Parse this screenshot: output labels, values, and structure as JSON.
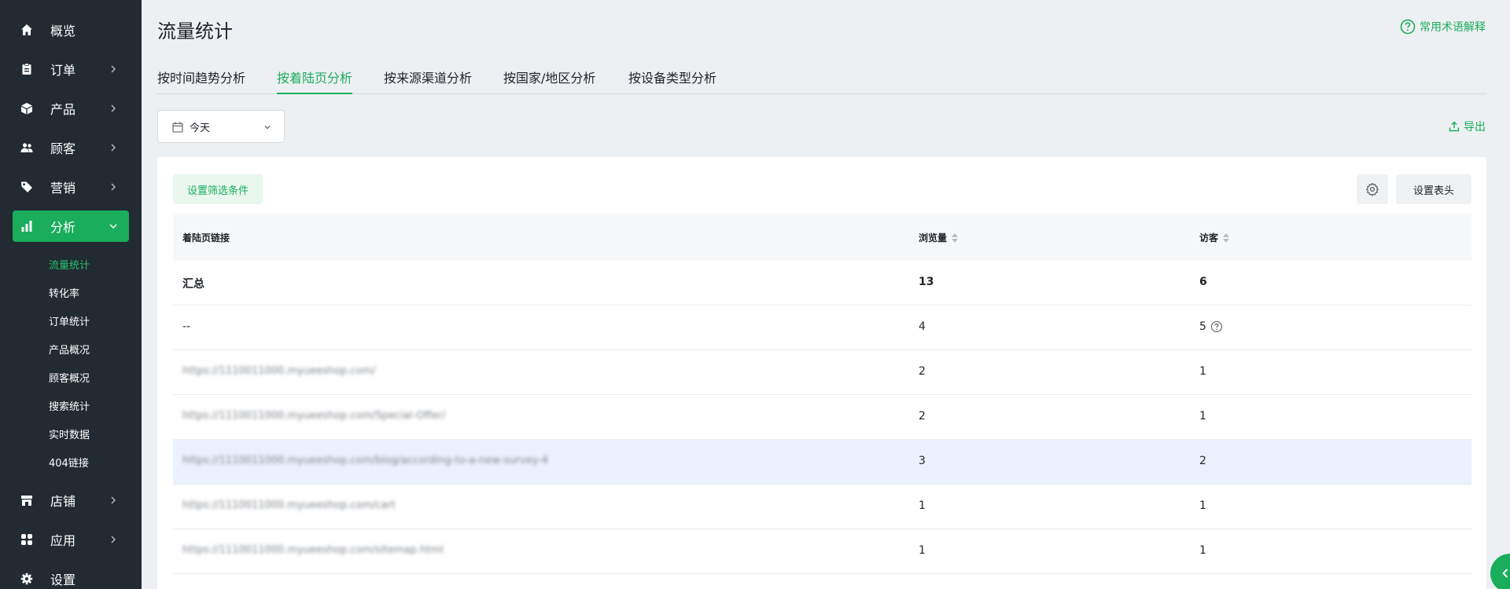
{
  "sidebar": {
    "items": [
      {
        "label": "概览",
        "icon": "home-icon"
      },
      {
        "label": "订单",
        "icon": "clipboard-icon"
      },
      {
        "label": "产品",
        "icon": "box-icon"
      },
      {
        "label": "顾客",
        "icon": "users-icon"
      },
      {
        "label": "营销",
        "icon": "tag-icon"
      },
      {
        "label": "分析",
        "icon": "chart-icon"
      },
      {
        "label": "店铺",
        "icon": "store-icon"
      },
      {
        "label": "应用",
        "icon": "apps-icon"
      },
      {
        "label": "设置",
        "icon": "gear-icon"
      }
    ],
    "sub_items": [
      "流量统计",
      "转化率",
      "订单统计",
      "产品概况",
      "顾客概况",
      "搜索统计",
      "实时数据",
      "404链接"
    ]
  },
  "header": {
    "title": "流量统计",
    "help_label": "常用术语解释"
  },
  "tabs": [
    "按时间趋势分析",
    "按着陆页分析",
    "按来源渠道分析",
    "按国家/地区分析",
    "按设备类型分析"
  ],
  "toolbar": {
    "date_value": "今天",
    "export_label": "导出",
    "filter_label": "设置筛选条件",
    "header_settings_label": "设置表头"
  },
  "table": {
    "columns": [
      "着陆页链接",
      "浏览量",
      "访客"
    ],
    "total": {
      "label": "汇总",
      "views": "13",
      "visitors": "6"
    },
    "rows": [
      {
        "url": "--",
        "views": "4",
        "visitors": "5"
      },
      {
        "url": "https://1110011000.myueeshop.com/",
        "views": "2",
        "visitors": "1"
      },
      {
        "url": "https://1110011000.myueeshop.com/Special-Offer/",
        "views": "2",
        "visitors": "1"
      },
      {
        "url": "https://1110011000.myueeshop.com/blog/according-to-a-new-survey-4",
        "views": "3",
        "visitors": "2"
      },
      {
        "url": "https://1110011000.myueeshop.com/cart",
        "views": "1",
        "visitors": "1"
      },
      {
        "url": "https://1110011000.myueeshop.com/sitemap.html",
        "views": "1",
        "visitors": "1"
      }
    ]
  },
  "colors": {
    "accent": "#1aad5c",
    "sidebar_bg": "#222a32",
    "page_bg": "#edf0f3",
    "highlight_row": "#eaf2fd"
  }
}
